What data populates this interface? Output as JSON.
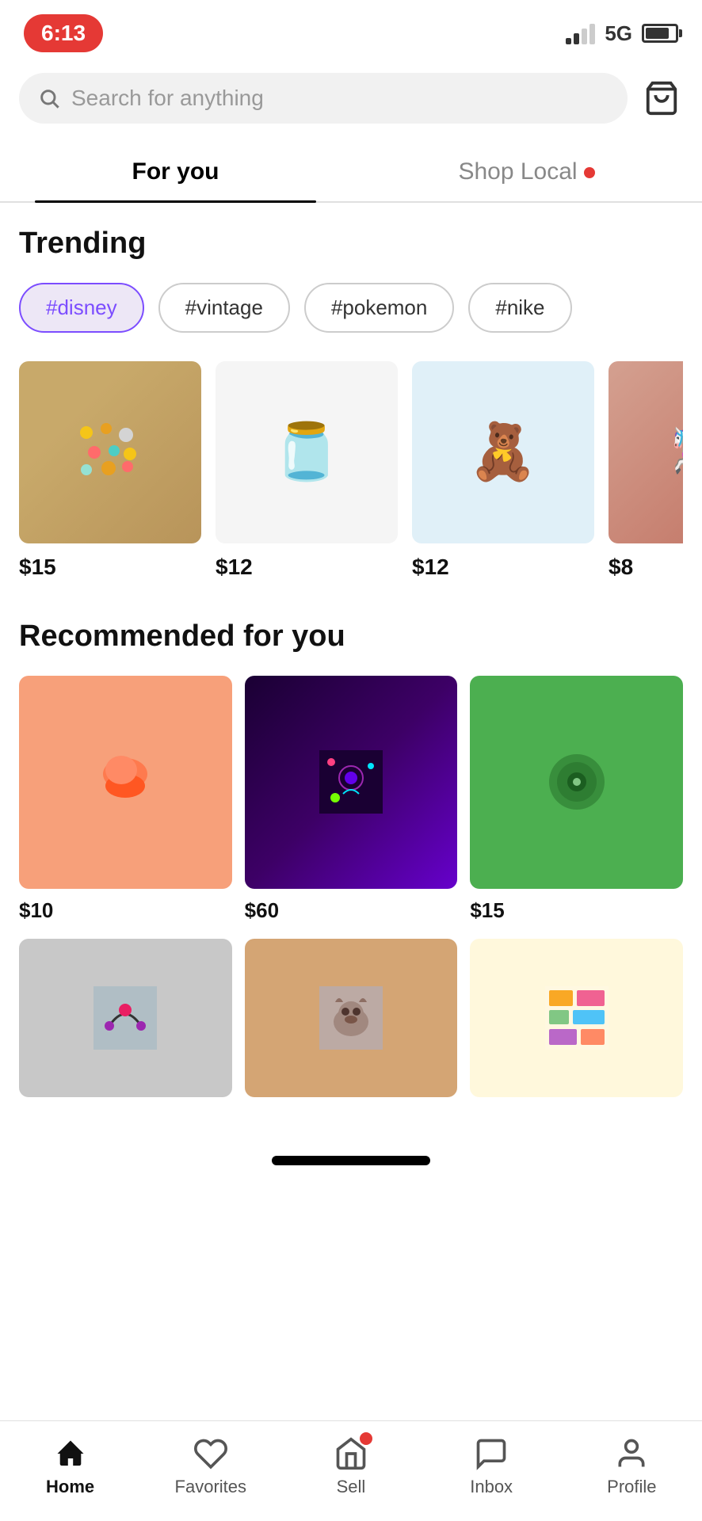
{
  "status": {
    "time": "6:13",
    "signal": "5G",
    "battery": 80
  },
  "search": {
    "placeholder": "Search for anything"
  },
  "tabs": [
    {
      "id": "for-you",
      "label": "For you",
      "active": true,
      "dot": false
    },
    {
      "id": "shop-local",
      "label": "Shop Local",
      "active": false,
      "dot": true
    }
  ],
  "trending": {
    "title": "Trending",
    "hashtags": [
      {
        "tag": "#disney",
        "active": true
      },
      {
        "tag": "#vintage",
        "active": false
      },
      {
        "tag": "#pokemon",
        "active": false
      },
      {
        "tag": "#nike",
        "active": false
      }
    ],
    "products": [
      {
        "price": "$15",
        "image_type": "pins"
      },
      {
        "price": "$12",
        "image_type": "mug"
      },
      {
        "price": "$12",
        "image_type": "plush"
      },
      {
        "price": "$8",
        "image_type": "misc"
      }
    ]
  },
  "recommended": {
    "title": "Recommended for you",
    "products_row1": [
      {
        "price": "$10",
        "image_type": "knit"
      },
      {
        "price": "$60",
        "image_type": "art"
      },
      {
        "price": "$15",
        "image_type": "green"
      }
    ],
    "products_row2": [
      {
        "price": "",
        "image_type": "necklace"
      },
      {
        "price": "",
        "image_type": "dog"
      },
      {
        "price": "",
        "image_type": "stickers"
      }
    ]
  },
  "bottom_nav": [
    {
      "id": "home",
      "label": "Home",
      "active": true,
      "icon": "home"
    },
    {
      "id": "favorites",
      "label": "Favorites",
      "active": false,
      "icon": "heart"
    },
    {
      "id": "sell",
      "label": "Sell",
      "active": false,
      "icon": "store",
      "dot": true
    },
    {
      "id": "inbox",
      "label": "Inbox",
      "active": false,
      "icon": "inbox"
    },
    {
      "id": "profile",
      "label": "Profile",
      "active": false,
      "icon": "person"
    }
  ]
}
